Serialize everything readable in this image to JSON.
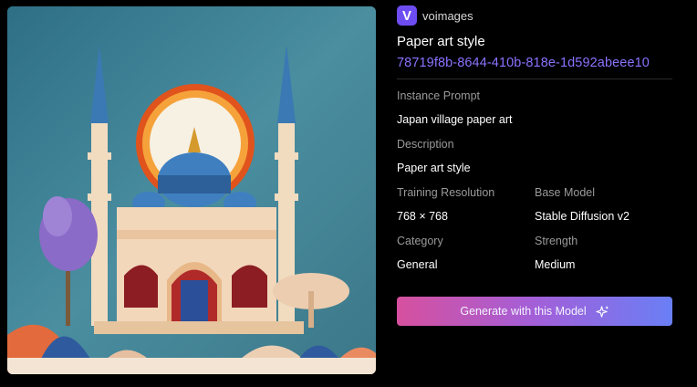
{
  "brand": {
    "logo_letter": "V",
    "name": "voimages"
  },
  "model": {
    "title": "Paper art style",
    "id": "78719f8b-8644-410b-818e-1d592abeee10"
  },
  "details": {
    "instance_prompt_label": "Instance Prompt",
    "instance_prompt_value": "Japan village paper art",
    "description_label": "Description",
    "description_value": "Paper art style",
    "training_resolution_label": "Training Resolution",
    "training_resolution_value": "768 × 768",
    "base_model_label": "Base Model",
    "base_model_value": "Stable Diffusion v2",
    "category_label": "Category",
    "category_value": "General",
    "strength_label": "Strength",
    "strength_value": "Medium"
  },
  "actions": {
    "generate_label": "Generate with this Model"
  },
  "preview": {
    "icon": "paper-art-mosque-image"
  },
  "colors": {
    "accent": "#8b72ff",
    "logo_bg": "#6d4df2",
    "button_start": "#d6509e",
    "button_end": "#6a7ff5"
  }
}
